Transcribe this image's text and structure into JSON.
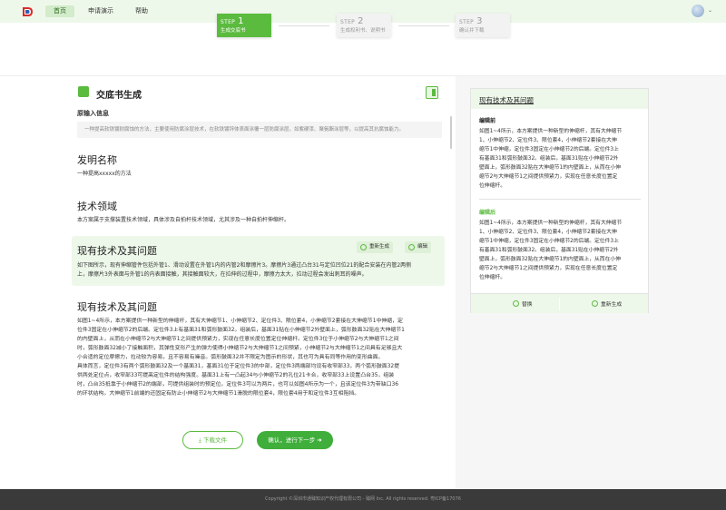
{
  "nav": {
    "items": [
      "首页",
      "申请演示",
      "帮助"
    ]
  },
  "steps": [
    {
      "label": "STEP",
      "num": "1",
      "sub": "生成交底书"
    },
    {
      "label": "STEP",
      "num": "2",
      "sub": "生成权利书、说明书"
    },
    {
      "label": "STEP",
      "num": "3",
      "sub": "确认并下载"
    }
  ],
  "header": {
    "title": "交底书生成"
  },
  "original": {
    "label": "原输入信息",
    "text": "一种提高软铁镀耐腐蚀的方法，主要使用防腐涂层技术，在软铁镀锌体表面涂覆一层防腐涂层，如紫硬漆、聚氨酯涂层等，以提高其抗腐蚀能力。"
  },
  "invention_name": {
    "title": "发明名称",
    "text": "一种提高xxxxx的方法"
  },
  "tech_field": {
    "title": "技术领域",
    "text": "本方案属于支撑装置技术领域，具体涉及自拍杆技术领域，尤其涉及一种自拍杆伸缩杆。"
  },
  "prior_art_hl": {
    "title": "现有技术及其问题",
    "regen": "重新生成",
    "edit": "编辑",
    "lines": [
      "如下图所示，现有伸缩管件包括外管1、滑动设置在外管1内的内管2和摩擦片3。摩擦片3通过凸台31与定位凹位21的配合安装在内管2两侧",
      "上，摩擦片3外表面与外管1的内表面接触，其接触面较大，在拉伸的过程中，摩擦力太大，拉动过程会发出刺耳的噪声。"
    ]
  },
  "prior_art": {
    "title": "现有技术及其问题",
    "lines": [
      "如图1~4所示，本方案提供一种新型的伸缩杆，其有大伸缩节1、小伸缩节2、定位件3、限位套4，小伸缩节2套接在大伸缩节1中伸缩，定",
      "位件3固定在小伸缩节2的后端。定位件3上有基面31和弧形鼓面32。组装后，基面31贴在小伸缩节2外壁面上，弧形鼓面32贴在大伸缩节1",
      "的内壁面上，从而在小伸缩节2与大伸缩节1之间提供预紧力，实现在任意长度位置定位伸缩杆。定位件3位于小伸缩节2与大伸缩节1之间",
      "时，弧形鼓面32减小了接触面积，其弹性变形产生的弹力使得小伸缩节2与大伸缩节1之间预紧，小伸缩节2与大伸缩节1之间具有足够且大",
      "小合适的定位摩擦力，拉动较为容易，且不容易有噪音。弧形鼓面32并不限定为图示的形状，其也可为具有同等作用的变形曲面。",
      "具体而言，定位件3有两个弧形鼓面32及一个基面31，基面31位于定位件3的中部，定位件3两端部均设有收窄部33，两个弧形鼓面32提",
      "供两处定位点，收窄部33可提高定位件的结构强度。基面31上有一凸起34与小伸缩节2的孔位21卡合，收窄部33上设置凸台35，组装",
      "时，凸台35抵靠于小伸缩节2的端部，可提供组装时的预定位。定位件3可以为两片，也可以如图4所示为一个，且该定位件3为带缺口36",
      "的环状结构。大伸缩节1前端的还固定有防止小伸缩节2与大伸缩节1滑脱的限位套4，限位套4用于和定位件3互相阻挡。"
    ]
  },
  "actions": {
    "download": "下载文件",
    "next": "确认，进行下一步"
  },
  "card": {
    "title": "现有技术及其问题",
    "before_label": "编辑前",
    "before_lines": [
      "如图1~4所示，本方案提供一种新型的伸缩杆，其有大伸缩节",
      "1、小伸缩节2、定位件3、限位套4，小伸缩节2套接在大伸",
      "缩节1中伸缩，定位件3固定在小伸缩节2的后端。定位件3上",
      "有基面31和弧形鼓面32。组装后，基面31贴在小伸缩节2外",
      "壁面上，弧形鼓面32贴在大伸缩节1的内壁面上，从而在小伸",
      "缩节2与大伸缩节1之间提供预紧力，实现在任意长度位置定",
      "位伸缩杆。"
    ],
    "after_label": "编辑后",
    "after_lines": [
      "如图1~4所示，本方案提供一种新型的伸缩杆，其有大伸缩节",
      "1、小伸缩节2、定位件3、限位套4，小伸缩节2套接在大伸",
      "缩节1中伸缩，定位件3固定在小伸缩节2的后端。定位件3上",
      "有基面31和弧形鼓面32。组装后，基面31贴在小伸缩节2外",
      "壁面上，弧形鼓面32贴在大伸缩节1的内壁面上，从而在小伸",
      "缩节2与大伸缩节1之间提供预紧力，实现在任意长度位置定",
      "位伸缩杆。"
    ],
    "replace": "替换",
    "regen": "重新生成"
  },
  "footer": {
    "text": "Copyright ©深圳市通臻知识产权代理有限公司 - 臻网 Inc. All rights reserved.  粤ICP备17076"
  },
  "colors": {
    "accent": "#5bbb3f",
    "topbar": "#eef8ea",
    "footer": "#3a3a3a"
  }
}
